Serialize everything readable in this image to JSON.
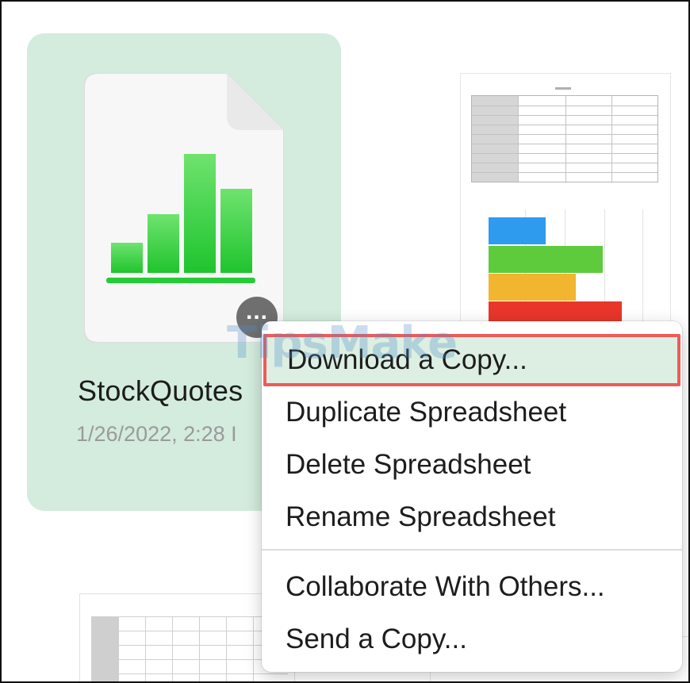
{
  "selected_file": {
    "name": "StockQuotes",
    "date": "1/26/2022, 2:28 I",
    "icon": "numbers-spreadsheet-icon",
    "more_button_glyph": "..."
  },
  "context_menu": {
    "items": [
      {
        "label": "Download a Copy..."
      },
      {
        "label": "Duplicate Spreadsheet"
      },
      {
        "label": "Delete Spreadsheet"
      },
      {
        "label": "Rename Spreadsheet"
      },
      {
        "label": "Collaborate With Others..."
      },
      {
        "label": "Send a Copy..."
      }
    ],
    "highlighted_index": 0
  },
  "thumbnail_right": {
    "bar_colors": [
      "#2e9bef",
      "#5ecb3c",
      "#f2b530",
      "#e8362b"
    ]
  },
  "watermark": "TipsMake",
  "colors": {
    "selection": "#d3ecdd",
    "highlight_border": "#ef5a5a",
    "numbers_green": "#2ecf3f"
  }
}
